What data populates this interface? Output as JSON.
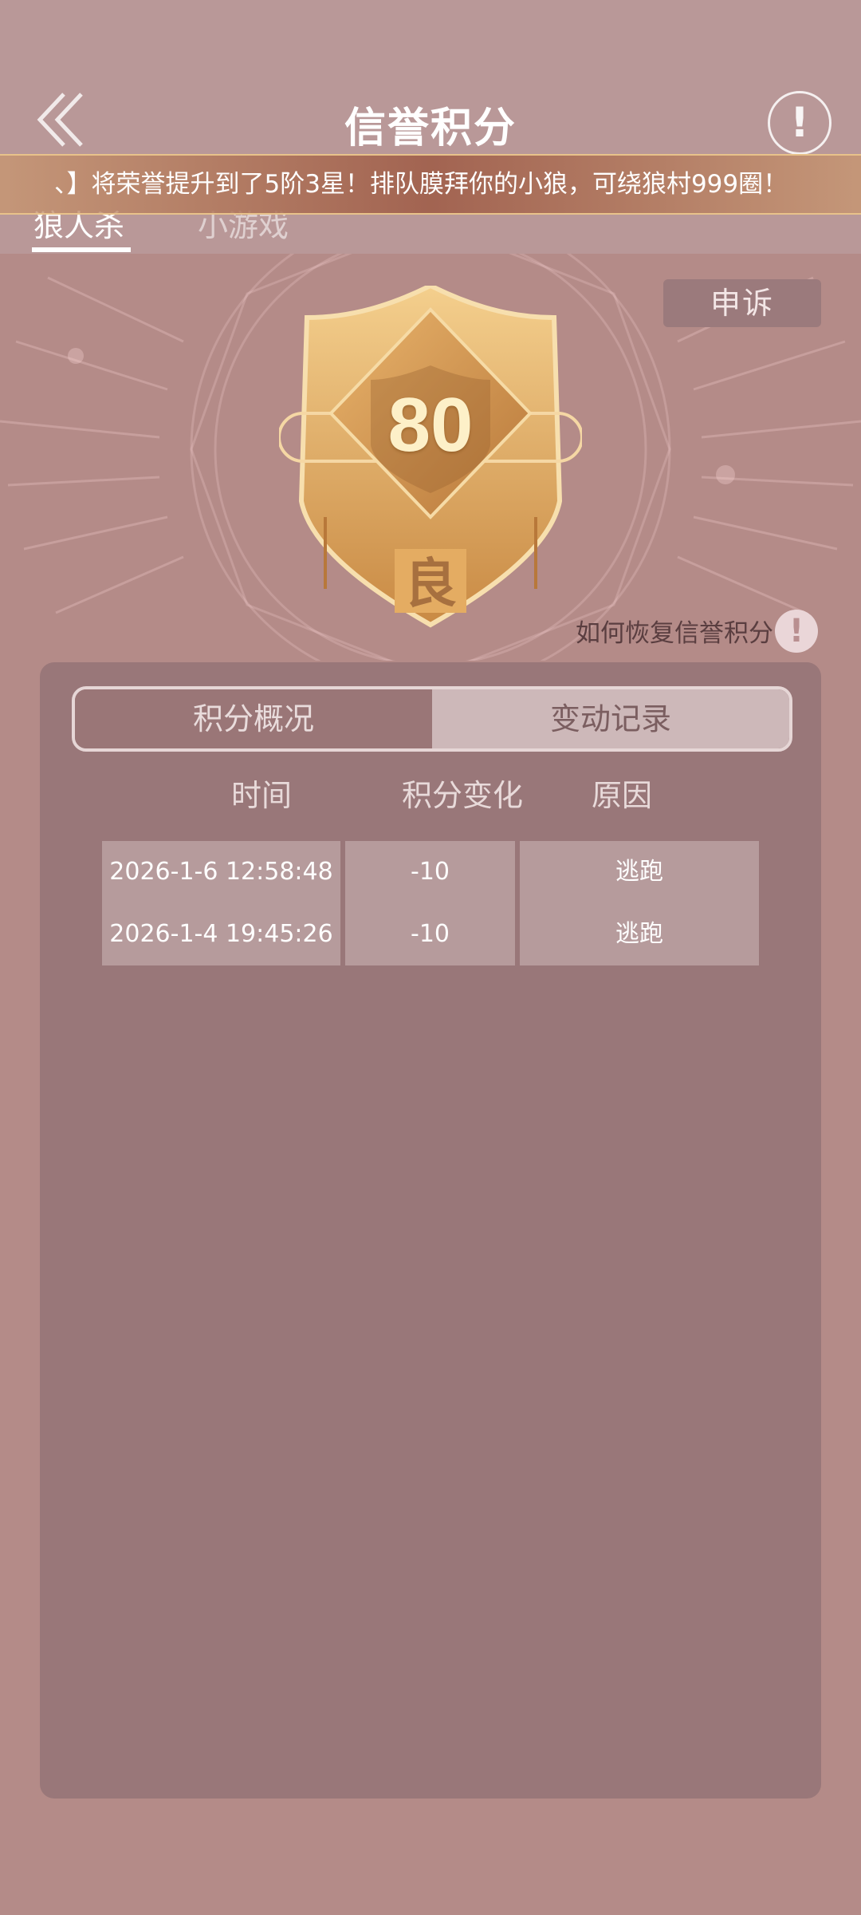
{
  "header": {
    "title": "信誉积分",
    "back_icon": "double-chevron-left-icon",
    "info_icon": "exclamation-circle-icon",
    "info_glyph": "!"
  },
  "marquee": {
    "text": "、】将荣誉提升到了5阶3星！排队膜拜你的小狼，可绕狼村999圈！"
  },
  "game_tabs": [
    {
      "label": "狼人杀",
      "active": true
    },
    {
      "label": "小游戏",
      "active": false
    }
  ],
  "badge": {
    "score": "80",
    "grade": "良"
  },
  "appeal_label": "申诉",
  "recover": {
    "label": "如何恢复信誉积分",
    "icon_glyph": "!"
  },
  "panel": {
    "tabs": [
      {
        "label": "积分概况",
        "selected": false
      },
      {
        "label": "变动记录",
        "selected": true
      }
    ],
    "columns": [
      "时间",
      "积分变化",
      "原因"
    ],
    "rows": [
      {
        "time": "2026-1-6 12:58:48",
        "change": "-10",
        "reason": "逃跑"
      },
      {
        "time": "2026-1-4 19:45:26",
        "change": "-10",
        "reason": "逃跑"
      }
    ]
  },
  "colors": {
    "page_bg": "#b48b88",
    "header_bg": "#b99898",
    "panel_bg": "#997779",
    "badge_gold": "#e3a962"
  }
}
